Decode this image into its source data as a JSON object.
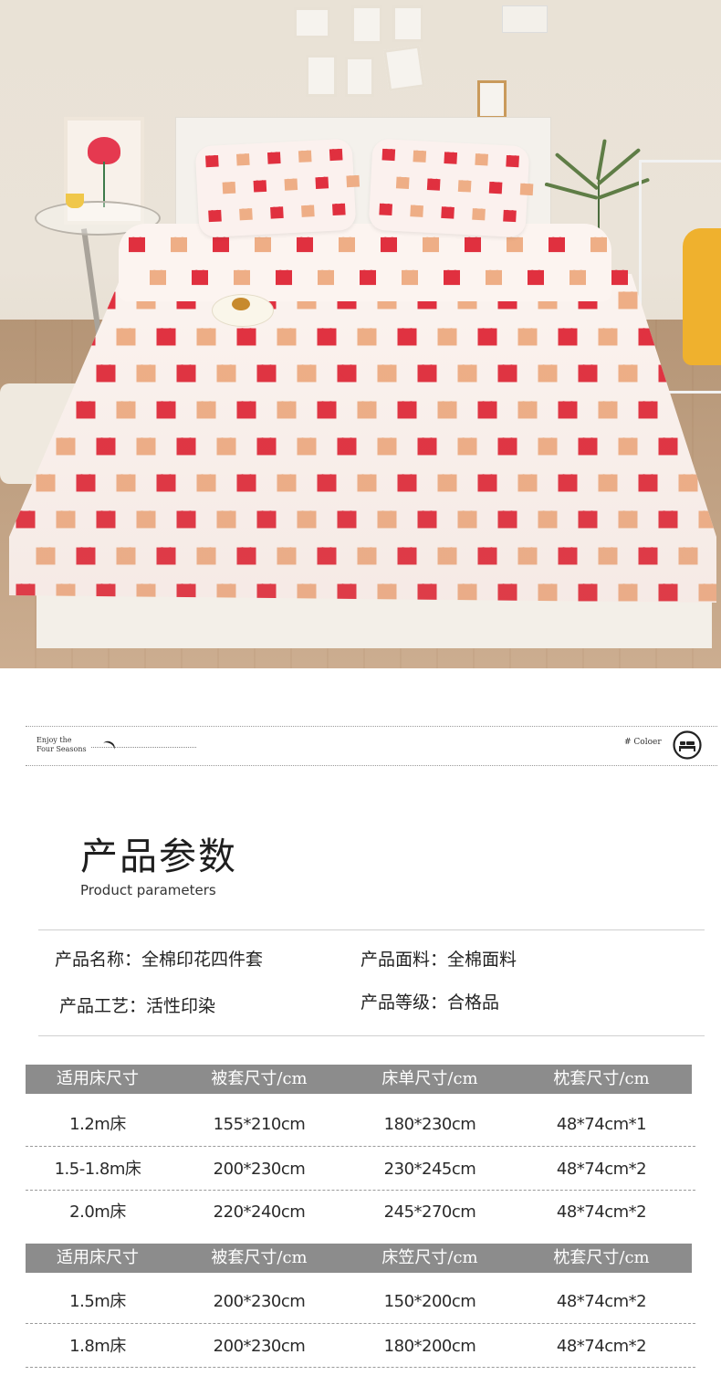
{
  "header_band": {
    "left_text_line1": "Enjoy the",
    "left_text_line2": "Four Seasons",
    "right_text": "#  Coloer",
    "icon": "bed-icon"
  },
  "section": {
    "title": "产品参数",
    "subtitle": "Product parameters"
  },
  "params": {
    "name_label": "产品名称：",
    "name_value": "全棉印花四件套",
    "fabric_label": "产品面料：",
    "fabric_value": "全棉面料",
    "craft_label": "产品工艺：",
    "craft_value": "活性印染",
    "grade_label": "产品等级：",
    "grade_value": "合格品"
  },
  "table1": {
    "headers": [
      "适用床尺寸",
      "被套尺寸/cm",
      "床单尺寸/cm",
      "枕套尺寸/cm"
    ],
    "rows": [
      [
        "1.2m床",
        "155*210cm",
        "180*230cm",
        "48*74cm*1"
      ],
      [
        "1.5-1.8m床",
        "200*230cm",
        "230*245cm",
        "48*74cm*2"
      ],
      [
        "2.0m床",
        "220*240cm",
        "245*270cm",
        "48*74cm*2"
      ]
    ]
  },
  "table2": {
    "headers": [
      "适用床尺寸",
      "被套尺寸/cm",
      "床笠尺寸/cm",
      "枕套尺寸/cm"
    ],
    "rows": [
      [
        "1.5m床",
        "200*230cm",
        "150*200cm",
        "48*74cm*2"
      ],
      [
        "1.8m床",
        "200*230cm",
        "180*200cm",
        "48*74cm*2"
      ]
    ]
  },
  "colors": {
    "heart_red": "#e0303f",
    "heart_peach": "#eeae86",
    "table_header_bg": "#8c8c8c"
  }
}
